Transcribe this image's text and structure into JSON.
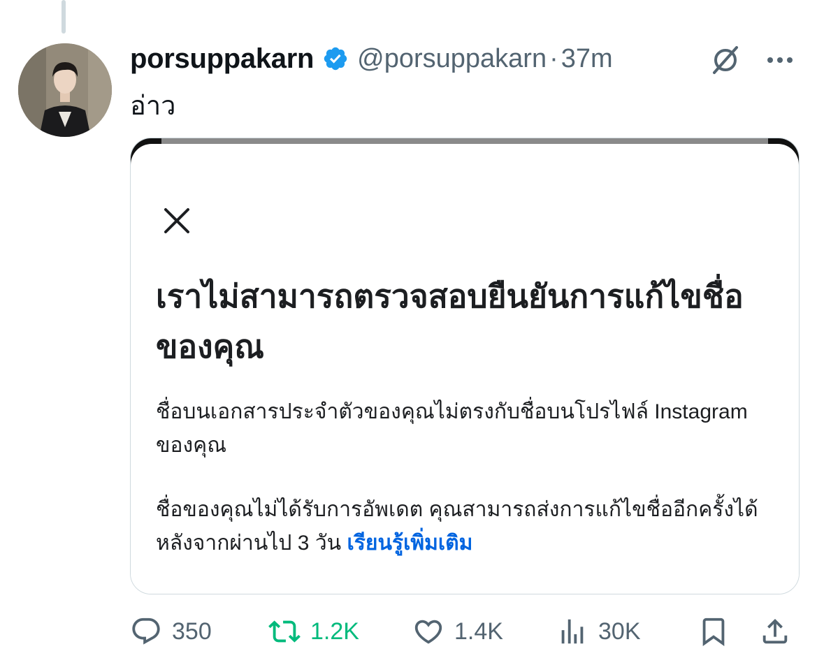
{
  "tweet": {
    "display_name": "porsuppakarn",
    "handle": "@porsuppakarn",
    "separator": "·",
    "time": "37m",
    "text": "อ่าว",
    "verified_icon": "verified-badge-icon",
    "grok_icon": "grok-icon",
    "more_icon": "more-icon"
  },
  "media": {
    "title": "เราไม่สามารถตรวจสอบยืนยันการแก้ไขชื่อของคุณ",
    "body1": "ชื่อบนเอกสารประจำตัวของคุณไม่ตรงกับชื่อบนโปรไฟล์ Instagram ของคุณ",
    "body2": "ชื่อของคุณไม่ได้รับการอัพเดต คุณสามารถส่งการแก้ไขชื่ออีกครั้งได้หลังจากผ่านไป 3 วัน",
    "learn_more": "เรียนรู้เพิ่มเติม",
    "close_icon": "close-icon",
    "link_color": "#0064e0"
  },
  "actions": {
    "replies": "350",
    "retweets": "1.2K",
    "likes": "1.4K",
    "views": "30K",
    "retweet_color": "#00ba7c",
    "icon_color": "#536471"
  }
}
